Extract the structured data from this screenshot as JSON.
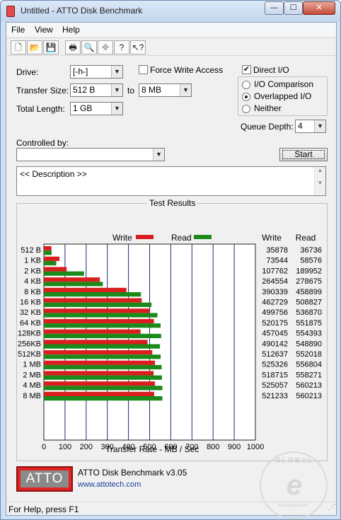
{
  "window": {
    "title": "Untitled - ATTO Disk Benchmark",
    "min_glyph": "—",
    "max_glyph": "☐",
    "close_glyph": "✕"
  },
  "menu": [
    "File",
    "View",
    "Help"
  ],
  "toolbar_icons": [
    "new-icon",
    "open-icon",
    "save-icon",
    "print-icon",
    "print-preview-icon",
    "move-icon",
    "help-icon",
    "context-help-icon"
  ],
  "settings": {
    "drive_label": "Drive:",
    "drive_value": "[-h-]",
    "transfer_size_label": "Transfer Size:",
    "transfer_from": "512 B",
    "to_label": "to",
    "transfer_to": "8 MB",
    "total_length_label": "Total Length:",
    "total_length_value": "1 GB",
    "force_write_label": "Force Write Access",
    "force_write_checked": false,
    "direct_io_label": "Direct I/O",
    "direct_io_checked": true,
    "io_comparison_label": "I/O Comparison",
    "overlapped_io_label": "Overlapped I/O",
    "neither_label": "Neither",
    "selected_mode": "Overlapped I/O",
    "queue_depth_label": "Queue Depth:",
    "queue_depth_value": "4",
    "controlled_by_label": "Controlled by:",
    "controlled_by_value": "",
    "start_label": "Start",
    "description": "<< Description >>"
  },
  "results": {
    "group_title": "Test Results",
    "write_legend": "Write",
    "read_legend": "Read",
    "write_header": "Write",
    "read_header": "Read",
    "write_color": "#d81e1e",
    "read_color": "#1b8a1b"
  },
  "chart_data": {
    "type": "bar",
    "orientation": "horizontal",
    "categories": [
      "512 B",
      "1 KB",
      "2 KB",
      "4 KB",
      "8 KB",
      "16 KB",
      "32 KB",
      "64 KB",
      "128KB",
      "256KB",
      "512KB",
      "1 MB",
      "2 MB",
      "4 MB",
      "8 MB"
    ],
    "series": [
      {
        "name": "Write",
        "values": [
          35878,
          73544,
          107762,
          264554,
          390339,
          462729,
          499756,
          520175,
          457045,
          490142,
          512637,
          525326,
          518715,
          525057,
          521233
        ]
      },
      {
        "name": "Read",
        "values": [
          36736,
          58576,
          189952,
          278675,
          458899,
          508827,
          536870,
          551875,
          554393,
          548890,
          552018,
          556804,
          558271,
          560213,
          560213
        ]
      }
    ],
    "xlabel": "Transfer Rate - MB / Sec",
    "xticks": [
      0,
      100,
      200,
      300,
      400,
      500,
      600,
      700,
      800,
      900,
      1000
    ],
    "xlim": [
      0,
      1000
    ],
    "value_scale_note": "values in KB/s"
  },
  "footer": {
    "logo_text": "ATTO",
    "product": "ATTO Disk Benchmark v3.05",
    "link": "www.attotech.com",
    "watermark_text": "GLOBAL",
    "watermark_sub": "www.gecid.com"
  },
  "status": "For Help, press F1"
}
